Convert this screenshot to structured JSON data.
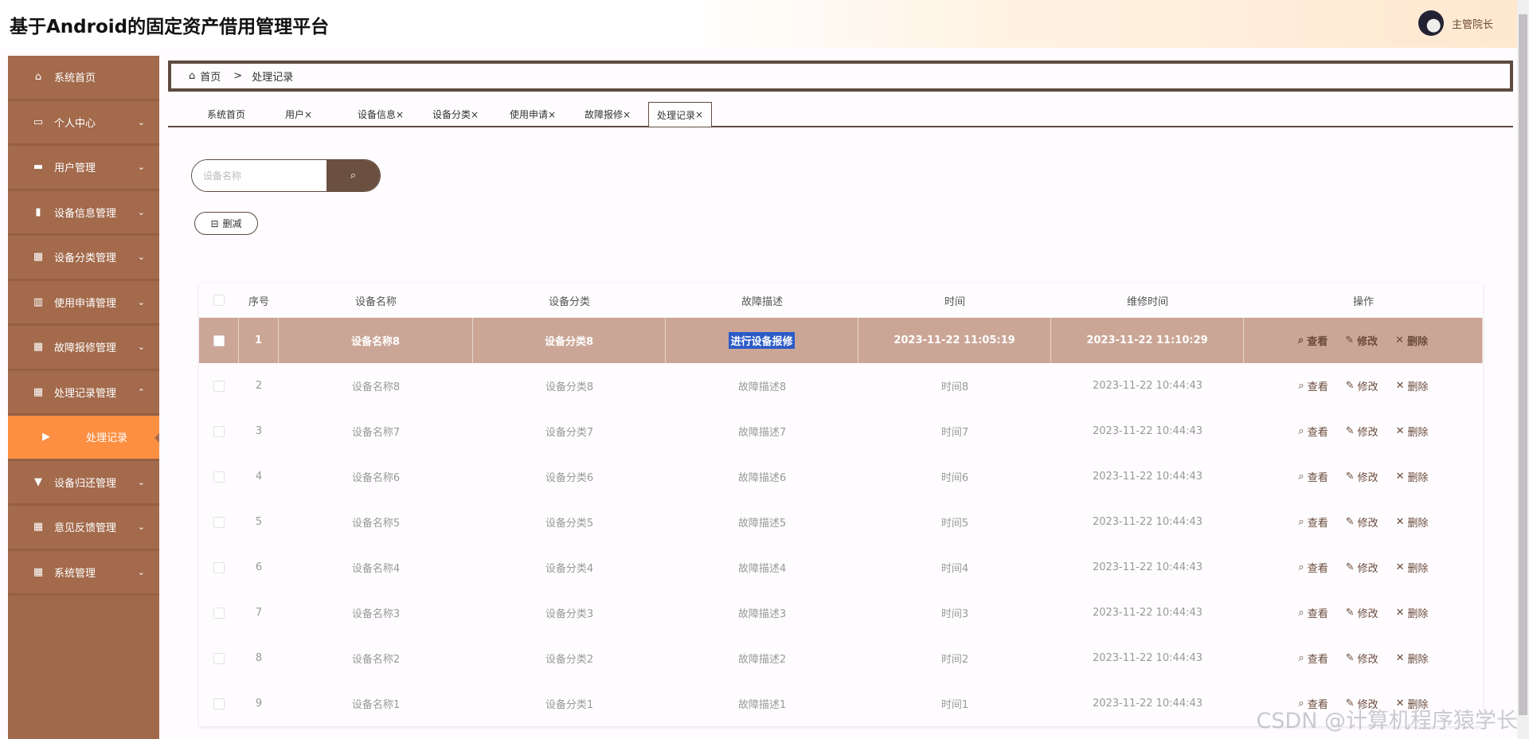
{
  "header": {
    "title": "基于Android的固定资产借用管理平台",
    "user": "主管院长"
  },
  "sidebar": {
    "items": [
      {
        "label": "系统首页",
        "icon": "home-icon",
        "glyph": "⌂",
        "chev": ""
      },
      {
        "label": "个人中心",
        "icon": "card-icon",
        "glyph": "▭",
        "chev": "⌄"
      },
      {
        "label": "用户管理",
        "icon": "monitor-icon",
        "glyph": "▬",
        "chev": "⌄"
      },
      {
        "label": "设备信息管理",
        "icon": "clipboard-icon",
        "glyph": "▮",
        "chev": "⌄"
      },
      {
        "label": "设备分类管理",
        "icon": "grid-icon",
        "glyph": "▦",
        "chev": "⌄"
      },
      {
        "label": "使用申请管理",
        "icon": "bar-chart-icon",
        "glyph": "▥",
        "chev": "⌄"
      },
      {
        "label": "故障报修管理",
        "icon": "grid-icon",
        "glyph": "▦",
        "chev": "⌄"
      },
      {
        "label": "处理记录管理",
        "icon": "grid-icon",
        "glyph": "▦",
        "chev": "⌃"
      },
      {
        "label": "处理记录",
        "icon": "caret-right-icon",
        "glyph": "▶",
        "chev": "",
        "active": true
      },
      {
        "label": "设备归还管理",
        "icon": "brush-icon",
        "glyph": "▼",
        "chev": "⌄"
      },
      {
        "label": "意见反馈管理",
        "icon": "grid-icon",
        "glyph": "▦",
        "chev": "⌄"
      },
      {
        "label": "系统管理",
        "icon": "grid-icon",
        "glyph": "▦",
        "chev": "⌄"
      }
    ]
  },
  "breadcrumb": {
    "home": "首页",
    "sep": ">",
    "current": "处理记录"
  },
  "tabs": [
    {
      "label": "系统首页",
      "close": ""
    },
    {
      "label": "用户",
      "close": "×"
    },
    {
      "label": "设备信息",
      "close": "×"
    },
    {
      "label": "设备分类",
      "close": "×"
    },
    {
      "label": "使用申请",
      "close": "×"
    },
    {
      "label": "故障报修",
      "close": "×"
    },
    {
      "label": "处理记录",
      "close": "×",
      "active": true
    }
  ],
  "search": {
    "placeholder": "设备名称",
    "value": ""
  },
  "toolbar": {
    "delete_label": "删减"
  },
  "table": {
    "columns": [
      "序号",
      "设备名称",
      "设备分类",
      "故障描述",
      "时间",
      "维修时间",
      "操作"
    ],
    "actions": {
      "view": "查看",
      "edit": "修改",
      "delete": "删除"
    },
    "rows": [
      [
        "1",
        "设备名称8",
        "设备分类8",
        "进行设备报修",
        "2023-11-22 11:05:19",
        "2023-11-22 11:10:29"
      ],
      [
        "2",
        "设备名称8",
        "设备分类8",
        "故障描述8",
        "时间8",
        "2023-11-22 10:44:43"
      ],
      [
        "3",
        "设备名称7",
        "设备分类7",
        "故障描述7",
        "时间7",
        "2023-11-22 10:44:43"
      ],
      [
        "4",
        "设备名称6",
        "设备分类6",
        "故障描述6",
        "时间6",
        "2023-11-22 10:44:43"
      ],
      [
        "5",
        "设备名称5",
        "设备分类5",
        "故障描述5",
        "时间5",
        "2023-11-22 10:44:43"
      ],
      [
        "6",
        "设备名称4",
        "设备分类4",
        "故障描述4",
        "时间4",
        "2023-11-22 10:44:43"
      ],
      [
        "7",
        "设备名称3",
        "设备分类3",
        "故障描述3",
        "时间3",
        "2023-11-22 10:44:43"
      ],
      [
        "8",
        "设备名称2",
        "设备分类2",
        "故障描述2",
        "时间2",
        "2023-11-22 10:44:43"
      ],
      [
        "9",
        "设备名称1",
        "设备分类1",
        "故障描述1",
        "时间1",
        "2023-11-22 10:44:43"
      ]
    ]
  },
  "watermark": "CSDN @计算机程序猿学长",
  "colors": {
    "sidebar": "#a36a4c",
    "active": "#fd8f42",
    "accent": "#5d4a40",
    "selected_row": "#cba697"
  }
}
